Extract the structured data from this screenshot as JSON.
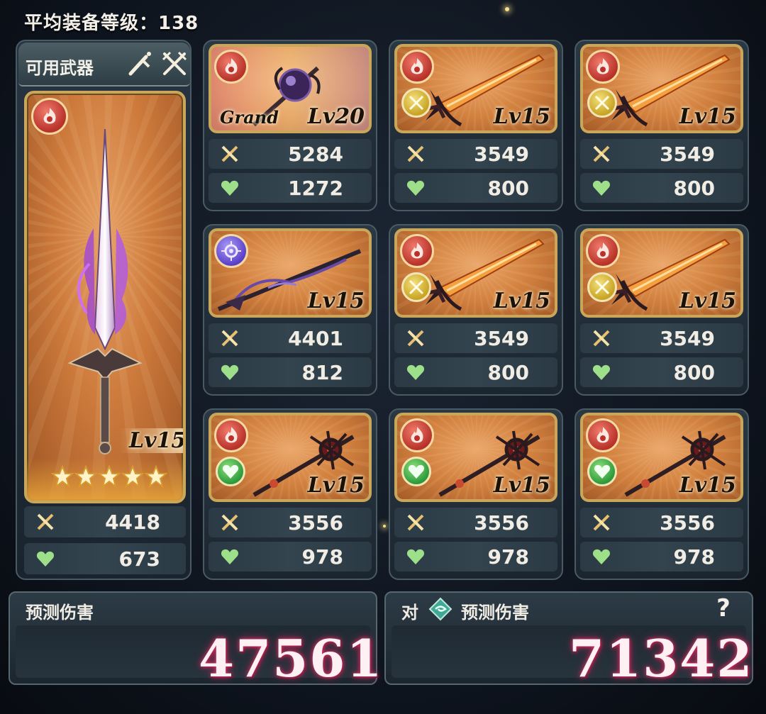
{
  "header": {
    "title": "平均装备等级：138"
  },
  "available_weapons": {
    "label": "可用武器",
    "icons": [
      "sword-icon",
      "crossed-swords-icon"
    ]
  },
  "main_weapon": {
    "element": "fire-element-icon",
    "level": "Lv15",
    "stars": 5,
    "atk": "4418",
    "hp": "673"
  },
  "weapons": [
    {
      "element": "fire",
      "sub": "",
      "grand": "Grand",
      "level": "Lv20",
      "atk": "5284",
      "hp": "1272",
      "art": "orb-staff"
    },
    {
      "element": "fire",
      "sub": "gold",
      "grand": "",
      "level": "Lv15",
      "atk": "3549",
      "hp": "800",
      "art": "flame-sword"
    },
    {
      "element": "fire",
      "sub": "gold",
      "grand": "",
      "level": "Lv15",
      "atk": "3549",
      "hp": "800",
      "art": "flame-sword"
    },
    {
      "element": "dark",
      "sub": "",
      "grand": "",
      "level": "Lv15",
      "atk": "4401",
      "hp": "812",
      "art": "dark-spear"
    },
    {
      "element": "fire",
      "sub": "gold",
      "grand": "",
      "level": "Lv15",
      "atk": "3549",
      "hp": "800",
      "art": "flame-sword"
    },
    {
      "element": "fire",
      "sub": "gold",
      "grand": "",
      "level": "Lv15",
      "atk": "3549",
      "hp": "800",
      "art": "flame-sword"
    },
    {
      "element": "fire",
      "sub": "green",
      "grand": "",
      "level": "Lv15",
      "atk": "3556",
      "hp": "978",
      "art": "thorn-staff"
    },
    {
      "element": "fire",
      "sub": "green",
      "grand": "",
      "level": "Lv15",
      "atk": "3556",
      "hp": "978",
      "art": "thorn-staff"
    },
    {
      "element": "fire",
      "sub": "green",
      "grand": "",
      "level": "Lv15",
      "atk": "3556",
      "hp": "978",
      "art": "thorn-staff"
    }
  ],
  "damage": {
    "label": "预测伤害",
    "value": "47561"
  },
  "vs_damage": {
    "prefix": "对",
    "label": "预测伤害",
    "value": "71342",
    "help": "?"
  },
  "colors": {
    "frame_gold": "#c9a65a",
    "card_orange": "#d2813f",
    "fire_red": "#b8322a",
    "dark_purple": "#5a3fc8",
    "damage_glow": "#d23a6a"
  }
}
